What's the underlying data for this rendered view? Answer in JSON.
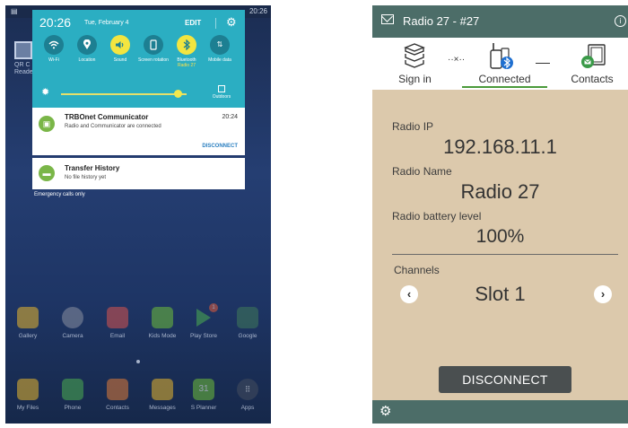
{
  "phone": {
    "status_time": "20:26",
    "qr_label": "QR C\nReade",
    "quick_settings": {
      "time": "20:26",
      "date": "Tue, February 4",
      "edit": "EDIT",
      "tiles": [
        {
          "label": "Wi-Fi",
          "icon": "wifi-icon"
        },
        {
          "label": "Location",
          "icon": "location-icon"
        },
        {
          "label": "Sound",
          "icon": "sound-icon"
        },
        {
          "label": "Screen rotation",
          "icon": "rotation-icon"
        },
        {
          "label": "Bluetooth",
          "sub": "Radio 27",
          "icon": "bluetooth-icon"
        },
        {
          "label": "Mobile data",
          "icon": "mobile-data-icon"
        }
      ],
      "outdoors": "Outdoors",
      "brightness_level": 0.93
    },
    "notifications": [
      {
        "title": "TRBOnet Communicator",
        "text": "Radio and Communicator are connected",
        "time": "20:24",
        "action": "DISCONNECT"
      },
      {
        "title": "Transfer History",
        "text": "No file history yet"
      }
    ],
    "emergency_text": "Emergency calls only",
    "apps_row1": [
      "Gallery",
      "Camera",
      "Email",
      "Kids Mode",
      "Play Store",
      "Google"
    ],
    "apps_row2": [
      "My Files",
      "Phone",
      "Contacts",
      "Messages",
      "S Planner",
      "Apps"
    ],
    "play_store_badge": "1",
    "planner_day": "31"
  },
  "app": {
    "title": "Radio 27 - #27",
    "tabs": [
      {
        "label": "Sign in"
      },
      {
        "label": "Connected",
        "active": true
      },
      {
        "label": "Contacts"
      }
    ],
    "radio_ip_label": "Radio IP",
    "radio_ip": "192.168.11.1",
    "radio_name_label": "Radio Name",
    "radio_name": "Radio 27",
    "battery_label": "Radio battery level",
    "battery_value": "100%",
    "channels_label": "Channels",
    "channel_value": "Slot 1",
    "disconnect_label": "DISCONNECT"
  }
}
